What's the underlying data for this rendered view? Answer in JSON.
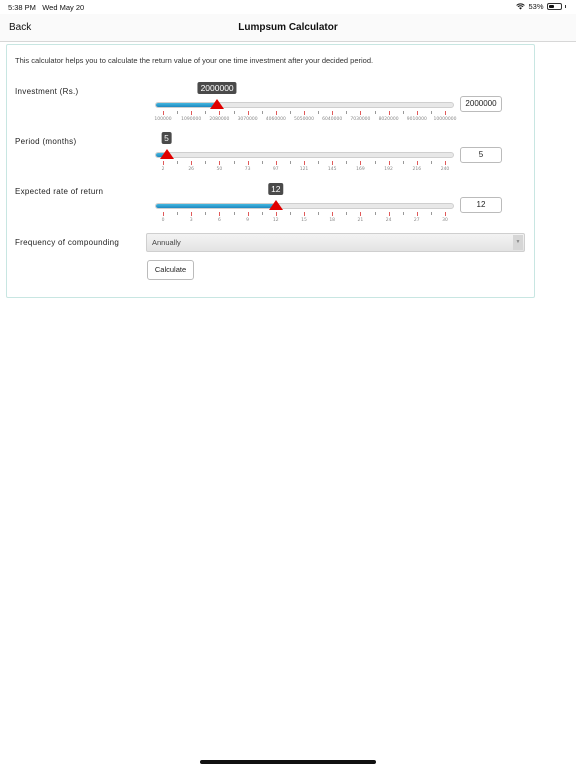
{
  "status_bar": {
    "time": "5:38 PM",
    "date": "Wed May 20",
    "battery": "53%",
    "battery_level": 0.53,
    "wifi_icon": "wifi-icon",
    "battery_icon": "battery-icon"
  },
  "nav": {
    "back_label": "Back",
    "title": "Lumpsum Calculator"
  },
  "intro": "This calculator helps you to calculate the return value of your one time investment after your decided period.",
  "investment": {
    "label": "Investment (Rs.)",
    "value": "2000000",
    "min": 100000,
    "max": 10000000,
    "current": 2000000,
    "ticks": [
      "100000",
      "1090000",
      "2080000",
      "3070000",
      "4060000",
      "5050000",
      "6040000",
      "7030000",
      "8020000",
      "9010000",
      "10000000"
    ]
  },
  "period": {
    "label": "Period (months)",
    "value": "5",
    "min": 2,
    "max": 240,
    "current": 5,
    "ticks": [
      "2",
      "26",
      "50",
      "73",
      "97",
      "121",
      "145",
      "169",
      "192",
      "216",
      "240"
    ]
  },
  "rate": {
    "label": "Expected rate of return",
    "value": "12",
    "min": 0,
    "max": 30,
    "current": 12,
    "ticks": [
      "0",
      "3",
      "6",
      "9",
      "12",
      "15",
      "18",
      "21",
      "24",
      "27",
      "30"
    ]
  },
  "frequency": {
    "label": "Frequency of compounding",
    "selected": "Annually"
  },
  "calculate_label": "Calculate",
  "colors": {
    "slider_fill": "#1e88c0",
    "handle": "#e00000",
    "card_border": "#c8e6e2"
  }
}
